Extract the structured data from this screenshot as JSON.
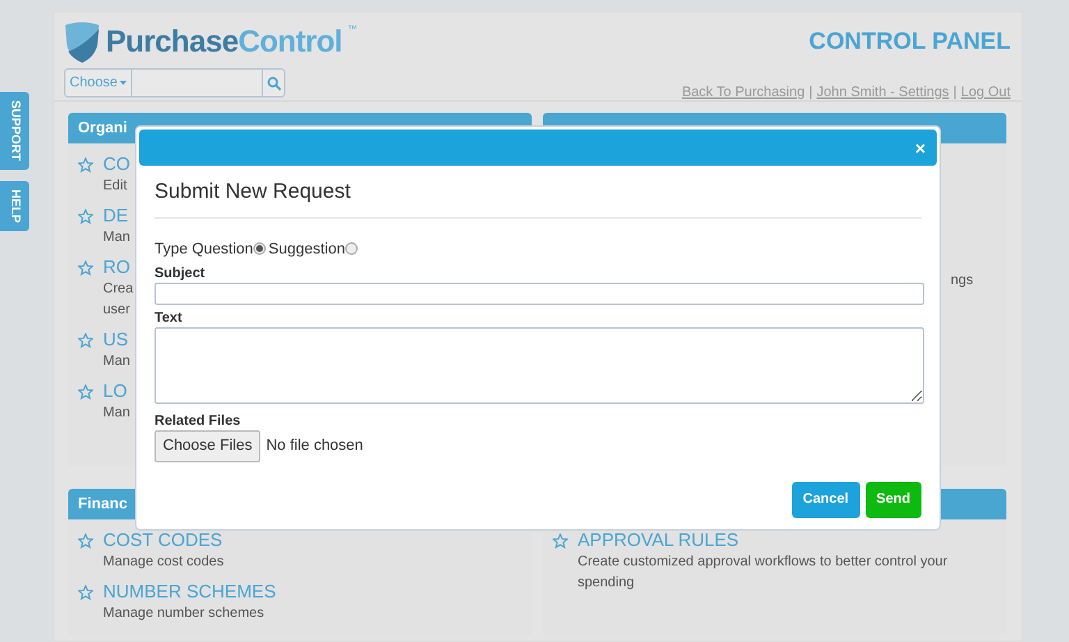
{
  "side_tabs": [
    {
      "label": "SUPPORT"
    },
    {
      "label": "HELP"
    }
  ],
  "header": {
    "logo_dark": "Purchase",
    "logo_light": "Control",
    "logo_mark": "™",
    "title": "CONTROL PANEL",
    "search": {
      "dropdown": "Choose"
    },
    "links": [
      "Back To Purchasing",
      "John Smith - Settings",
      "Log Out"
    ],
    "separators": [
      "|",
      "|"
    ]
  },
  "panels": [
    {
      "title": "Organi",
      "items": [
        {
          "title": "CO",
          "description": [
            "Edit"
          ]
        },
        {
          "title": "DE",
          "description": [
            "Man"
          ]
        },
        {
          "title": "RO",
          "description": [
            "Crea",
            "user"
          ]
        },
        {
          "title": "US",
          "description": [
            "Man"
          ]
        },
        {
          "title": "LO",
          "description": [
            "Man"
          ]
        }
      ]
    },
    {
      "items": [
        {
          "description": [
            "ngs"
          ]
        }
      ]
    },
    {
      "title": "Financ",
      "items": [
        {
          "title": "COST CODES",
          "description": [
            "Manage cost codes"
          ]
        },
        {
          "title": "NUMBER SCHEMES",
          "description": [
            "Manage number schemes"
          ]
        }
      ]
    },
    {
      "items": [
        {
          "title": "APPROVAL RULES",
          "description": [
            "Create customized approval workflows to better control your",
            "spending"
          ]
        }
      ]
    }
  ],
  "modal": {
    "close": "×",
    "title": "Submit New Request",
    "type_label": "Type",
    "radios": [
      {
        "label": "Question",
        "selected": true
      },
      {
        "label": "Suggestion",
        "selected": false
      }
    ],
    "subject_label": "Subject",
    "text_label": "Text",
    "files_label": "Related Files",
    "file_button": "Choose Files",
    "file_status": "No file chosen",
    "buttons": [
      {
        "label": "Cancel",
        "kind": "cancel"
      },
      {
        "label": "Send",
        "kind": "send"
      }
    ]
  }
}
